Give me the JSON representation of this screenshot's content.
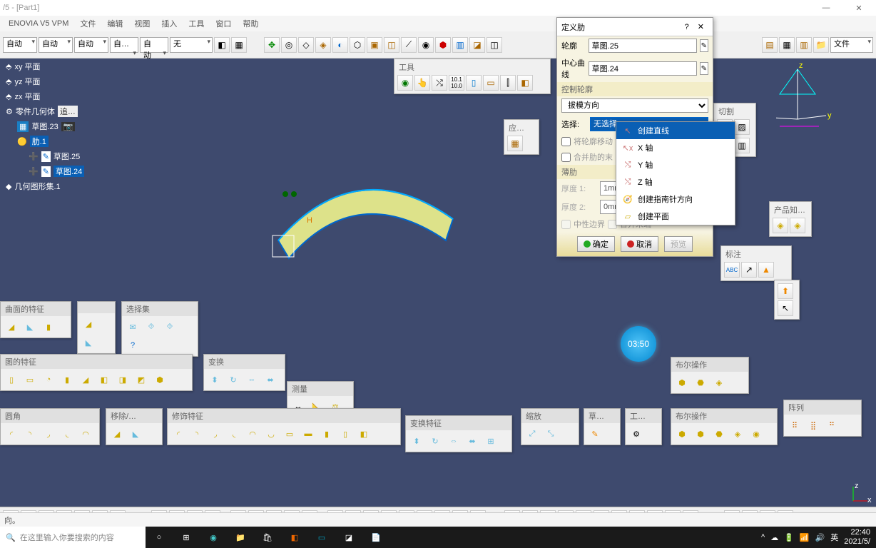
{
  "title": "/5 - [Part1]",
  "menu": {
    "vpm": "ENOVIA V5 VPM",
    "file": "文件",
    "edit": "编辑",
    "view": "视图",
    "insert": "插入",
    "tools": "工具",
    "window": "窗口",
    "help": "帮助"
  },
  "top": {
    "auto1": "自动",
    "auto2": "自动",
    "auto3": "自动",
    "auto4": "自…",
    "auto5": "自动",
    "none": "无",
    "file_combo": "文件"
  },
  "tree": {
    "xy": "xy 平面",
    "yz": "yz 平面",
    "zx": "zx 平面",
    "geom": "零件几何体",
    "sk23": "草图.23",
    "rib1": "肋.1",
    "sk25": "草图.25",
    "sk24": "草图.24",
    "set1": "几何图形集.1",
    "i5": "5",
    "zhui": "追…"
  },
  "dialog": {
    "title": "定义肋",
    "profile_lbl": "轮廓",
    "profile_val": "草图.25",
    "center_lbl": "中心曲线",
    "center_val": "草图.24",
    "control": "控制轮廓",
    "direction": "拔模方向",
    "select_lbl": "选择:",
    "select_val": "无选择",
    "move_profile": "将轮廓移动",
    "merge_end": "合并肋的末",
    "thin": "薄肋",
    "thick1_lbl": "厚度 1:",
    "thick1_val": "1mm",
    "thick2_lbl": "厚度 2:",
    "thick2_val": "0mm",
    "neutral": "中性边界",
    "merge_ends": "合并末端",
    "ok": "确定",
    "cancel": "取消",
    "preview": "预览"
  },
  "context": {
    "create_line": "创建直线",
    "x_axis": "X 轴",
    "y_axis": "Y 轴",
    "z_axis": "Z 轴",
    "compass": "创建指南针方向",
    "create_plane": "创建平面"
  },
  "timer": "03:50",
  "palettes": {
    "tool": "工具",
    "app": "应…",
    "surf_feat": "曲面的特征",
    "sel_set": "选择集",
    "diag_feat": "图的特征",
    "transform": "变换",
    "measure": "测量",
    "fillet": "圆角",
    "remove": "移除/…",
    "dress": "修饰特征",
    "trans_feat": "变换特征",
    "scale": "缩放",
    "sketch": "草…",
    "work": "工…",
    "bool": "布尔操作",
    "bool2": "布尔操作",
    "array": "阵列",
    "annot": "标注",
    "prod": "产品知…",
    "cut": "切割"
  },
  "status": "向。",
  "task": {
    "search": "在这里输入你要搜索的内容",
    "ime": "英",
    "time": "22:40",
    "date": "2021/5/"
  }
}
